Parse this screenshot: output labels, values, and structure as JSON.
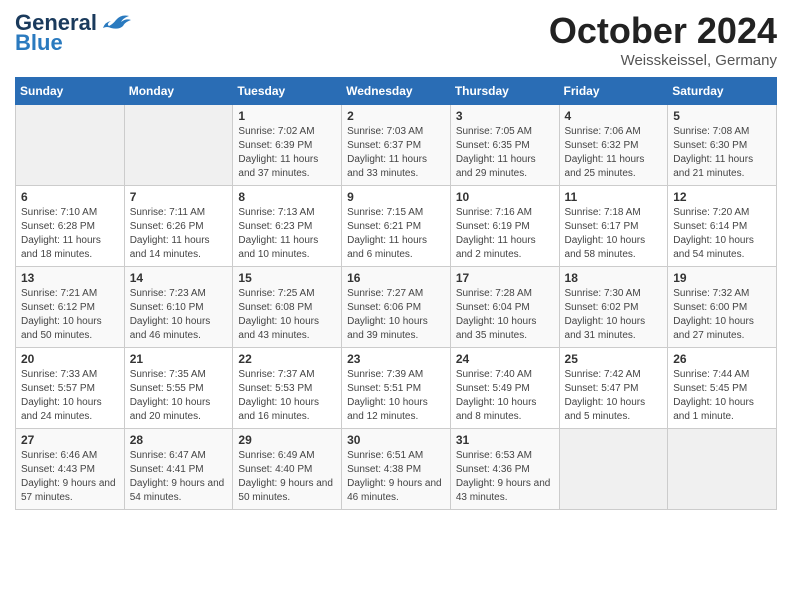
{
  "header": {
    "logo_general": "General",
    "logo_blue": "Blue",
    "month_title": "October 2024",
    "location": "Weisskeissel, Germany"
  },
  "weekdays": [
    "Sunday",
    "Monday",
    "Tuesday",
    "Wednesday",
    "Thursday",
    "Friday",
    "Saturday"
  ],
  "weeks": [
    [
      {
        "day": "",
        "info": ""
      },
      {
        "day": "",
        "info": ""
      },
      {
        "day": "1",
        "info": "Sunrise: 7:02 AM\nSunset: 6:39 PM\nDaylight: 11 hours and 37 minutes."
      },
      {
        "day": "2",
        "info": "Sunrise: 7:03 AM\nSunset: 6:37 PM\nDaylight: 11 hours and 33 minutes."
      },
      {
        "day": "3",
        "info": "Sunrise: 7:05 AM\nSunset: 6:35 PM\nDaylight: 11 hours and 29 minutes."
      },
      {
        "day": "4",
        "info": "Sunrise: 7:06 AM\nSunset: 6:32 PM\nDaylight: 11 hours and 25 minutes."
      },
      {
        "day": "5",
        "info": "Sunrise: 7:08 AM\nSunset: 6:30 PM\nDaylight: 11 hours and 21 minutes."
      }
    ],
    [
      {
        "day": "6",
        "info": "Sunrise: 7:10 AM\nSunset: 6:28 PM\nDaylight: 11 hours and 18 minutes."
      },
      {
        "day": "7",
        "info": "Sunrise: 7:11 AM\nSunset: 6:26 PM\nDaylight: 11 hours and 14 minutes."
      },
      {
        "day": "8",
        "info": "Sunrise: 7:13 AM\nSunset: 6:23 PM\nDaylight: 11 hours and 10 minutes."
      },
      {
        "day": "9",
        "info": "Sunrise: 7:15 AM\nSunset: 6:21 PM\nDaylight: 11 hours and 6 minutes."
      },
      {
        "day": "10",
        "info": "Sunrise: 7:16 AM\nSunset: 6:19 PM\nDaylight: 11 hours and 2 minutes."
      },
      {
        "day": "11",
        "info": "Sunrise: 7:18 AM\nSunset: 6:17 PM\nDaylight: 10 hours and 58 minutes."
      },
      {
        "day": "12",
        "info": "Sunrise: 7:20 AM\nSunset: 6:14 PM\nDaylight: 10 hours and 54 minutes."
      }
    ],
    [
      {
        "day": "13",
        "info": "Sunrise: 7:21 AM\nSunset: 6:12 PM\nDaylight: 10 hours and 50 minutes."
      },
      {
        "day": "14",
        "info": "Sunrise: 7:23 AM\nSunset: 6:10 PM\nDaylight: 10 hours and 46 minutes."
      },
      {
        "day": "15",
        "info": "Sunrise: 7:25 AM\nSunset: 6:08 PM\nDaylight: 10 hours and 43 minutes."
      },
      {
        "day": "16",
        "info": "Sunrise: 7:27 AM\nSunset: 6:06 PM\nDaylight: 10 hours and 39 minutes."
      },
      {
        "day": "17",
        "info": "Sunrise: 7:28 AM\nSunset: 6:04 PM\nDaylight: 10 hours and 35 minutes."
      },
      {
        "day": "18",
        "info": "Sunrise: 7:30 AM\nSunset: 6:02 PM\nDaylight: 10 hours and 31 minutes."
      },
      {
        "day": "19",
        "info": "Sunrise: 7:32 AM\nSunset: 6:00 PM\nDaylight: 10 hours and 27 minutes."
      }
    ],
    [
      {
        "day": "20",
        "info": "Sunrise: 7:33 AM\nSunset: 5:57 PM\nDaylight: 10 hours and 24 minutes."
      },
      {
        "day": "21",
        "info": "Sunrise: 7:35 AM\nSunset: 5:55 PM\nDaylight: 10 hours and 20 minutes."
      },
      {
        "day": "22",
        "info": "Sunrise: 7:37 AM\nSunset: 5:53 PM\nDaylight: 10 hours and 16 minutes."
      },
      {
        "day": "23",
        "info": "Sunrise: 7:39 AM\nSunset: 5:51 PM\nDaylight: 10 hours and 12 minutes."
      },
      {
        "day": "24",
        "info": "Sunrise: 7:40 AM\nSunset: 5:49 PM\nDaylight: 10 hours and 8 minutes."
      },
      {
        "day": "25",
        "info": "Sunrise: 7:42 AM\nSunset: 5:47 PM\nDaylight: 10 hours and 5 minutes."
      },
      {
        "day": "26",
        "info": "Sunrise: 7:44 AM\nSunset: 5:45 PM\nDaylight: 10 hours and 1 minute."
      }
    ],
    [
      {
        "day": "27",
        "info": "Sunrise: 6:46 AM\nSunset: 4:43 PM\nDaylight: 9 hours and 57 minutes."
      },
      {
        "day": "28",
        "info": "Sunrise: 6:47 AM\nSunset: 4:41 PM\nDaylight: 9 hours and 54 minutes."
      },
      {
        "day": "29",
        "info": "Sunrise: 6:49 AM\nSunset: 4:40 PM\nDaylight: 9 hours and 50 minutes."
      },
      {
        "day": "30",
        "info": "Sunrise: 6:51 AM\nSunset: 4:38 PM\nDaylight: 9 hours and 46 minutes."
      },
      {
        "day": "31",
        "info": "Sunrise: 6:53 AM\nSunset: 4:36 PM\nDaylight: 9 hours and 43 minutes."
      },
      {
        "day": "",
        "info": ""
      },
      {
        "day": "",
        "info": ""
      }
    ]
  ]
}
